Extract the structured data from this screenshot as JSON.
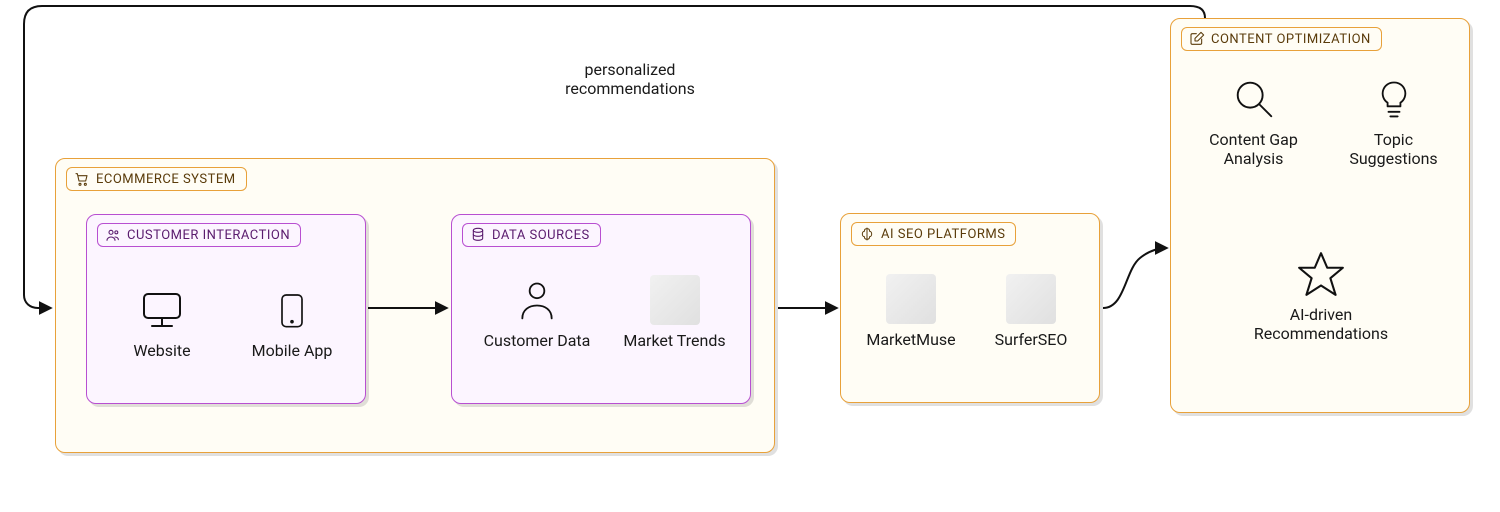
{
  "groups": {
    "ecommerce": {
      "title": "ECOMMERCE SYSTEM"
    },
    "customer_interaction": {
      "title": "CUSTOMER INTERACTION"
    },
    "data_sources": {
      "title": "DATA SOURCES"
    },
    "ai_seo": {
      "title": "AI SEO PLATFORMS"
    },
    "content_opt": {
      "title": "CONTENT OPTIMIZATION"
    }
  },
  "nodes": {
    "website": {
      "label": "Website"
    },
    "mobile_app": {
      "label": "Mobile App"
    },
    "customer_data": {
      "label": "Customer Data"
    },
    "market_trends": {
      "label": "Market Trends"
    },
    "marketmuse": {
      "label": "MarketMuse"
    },
    "surferseo": {
      "label": "SurferSEO"
    },
    "content_gap": {
      "label": "Content Gap Analysis"
    },
    "topic_suggestions": {
      "label": "Topic Suggestions"
    },
    "ai_recs": {
      "label": "AI-driven Recommendations"
    }
  },
  "edges": {
    "feedback": {
      "label": "personalized recommendations"
    }
  }
}
